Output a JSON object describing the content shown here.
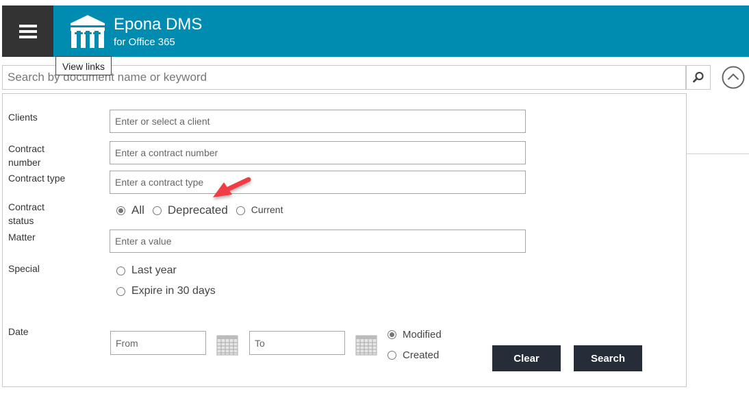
{
  "header": {
    "menu_icon": "hamburger-icon",
    "logo_icon": "building-columns-icon",
    "title": "Epona DMS",
    "subtitle": "for Office 365",
    "brand_color": "#008bb1",
    "menu_bg_color": "#333333"
  },
  "tooltip": {
    "text": "View links"
  },
  "search": {
    "placeholder": "Search by document name or keyword",
    "value": "",
    "search_icon": "search-icon",
    "collapse_icon": "chevron-up-circle-icon"
  },
  "form": {
    "clients": {
      "label": "Clients",
      "placeholder": "Enter or select a client"
    },
    "contract_number": {
      "label": "Contract number",
      "placeholder": "Enter a contract number"
    },
    "contract_type": {
      "label": "Contract type",
      "placeholder": "Enter a contract type"
    },
    "contract_status": {
      "label": "Contract status",
      "options": [
        {
          "label": "All",
          "checked": true
        },
        {
          "label": "Deprecated",
          "checked": false
        },
        {
          "label": "Current",
          "checked": false
        }
      ]
    },
    "matter": {
      "label": "Matter",
      "placeholder": "Enter a value"
    },
    "special": {
      "label": "Special",
      "options": [
        {
          "label": "Last year",
          "checked": false
        },
        {
          "label": "Expire in 30 days",
          "checked": false
        }
      ]
    },
    "date": {
      "label": "Date",
      "from_placeholder": "From",
      "to_placeholder": "To",
      "calendar_icon": "calendar-icon",
      "options": [
        {
          "label": "Modified",
          "checked": true
        },
        {
          "label": "Created",
          "checked": false
        }
      ]
    }
  },
  "buttons": {
    "clear": "Clear",
    "search": "Search",
    "button_color": "#262c38"
  },
  "annotation": {
    "arrow_color": "#f03c45"
  }
}
